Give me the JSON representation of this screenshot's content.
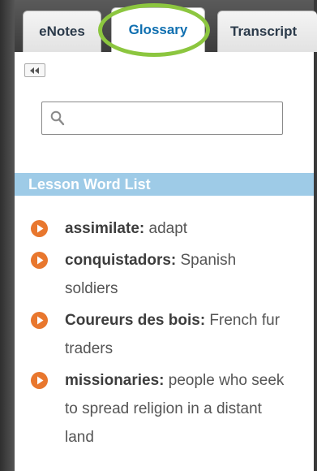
{
  "tabs": [
    {
      "label": "eNotes",
      "active": false
    },
    {
      "label": "Glossary",
      "active": true
    },
    {
      "label": "Transcript",
      "active": false
    }
  ],
  "search": {
    "placeholder": "",
    "value": ""
  },
  "word_list": {
    "title": "Lesson Word List",
    "terms": [
      {
        "term": "assimilate:",
        "definition": " adapt"
      },
      {
        "term": "conquistadors:",
        "definition": " Spanish soldiers"
      },
      {
        "term": "Coureurs des bois:",
        "definition": " French fur traders"
      },
      {
        "term": "missionaries:",
        "definition": " people who seek to spread religion in a distant land"
      }
    ]
  },
  "icons": {
    "collapse": "double-chevron-left-icon",
    "search": "search-icon",
    "play": "play-circle-icon"
  },
  "colors": {
    "active_tab_text": "#0f6fb0",
    "highlight_ring": "#8cc63f",
    "header_bg": "#9ecbe7",
    "play_icon": "#e8772e"
  }
}
